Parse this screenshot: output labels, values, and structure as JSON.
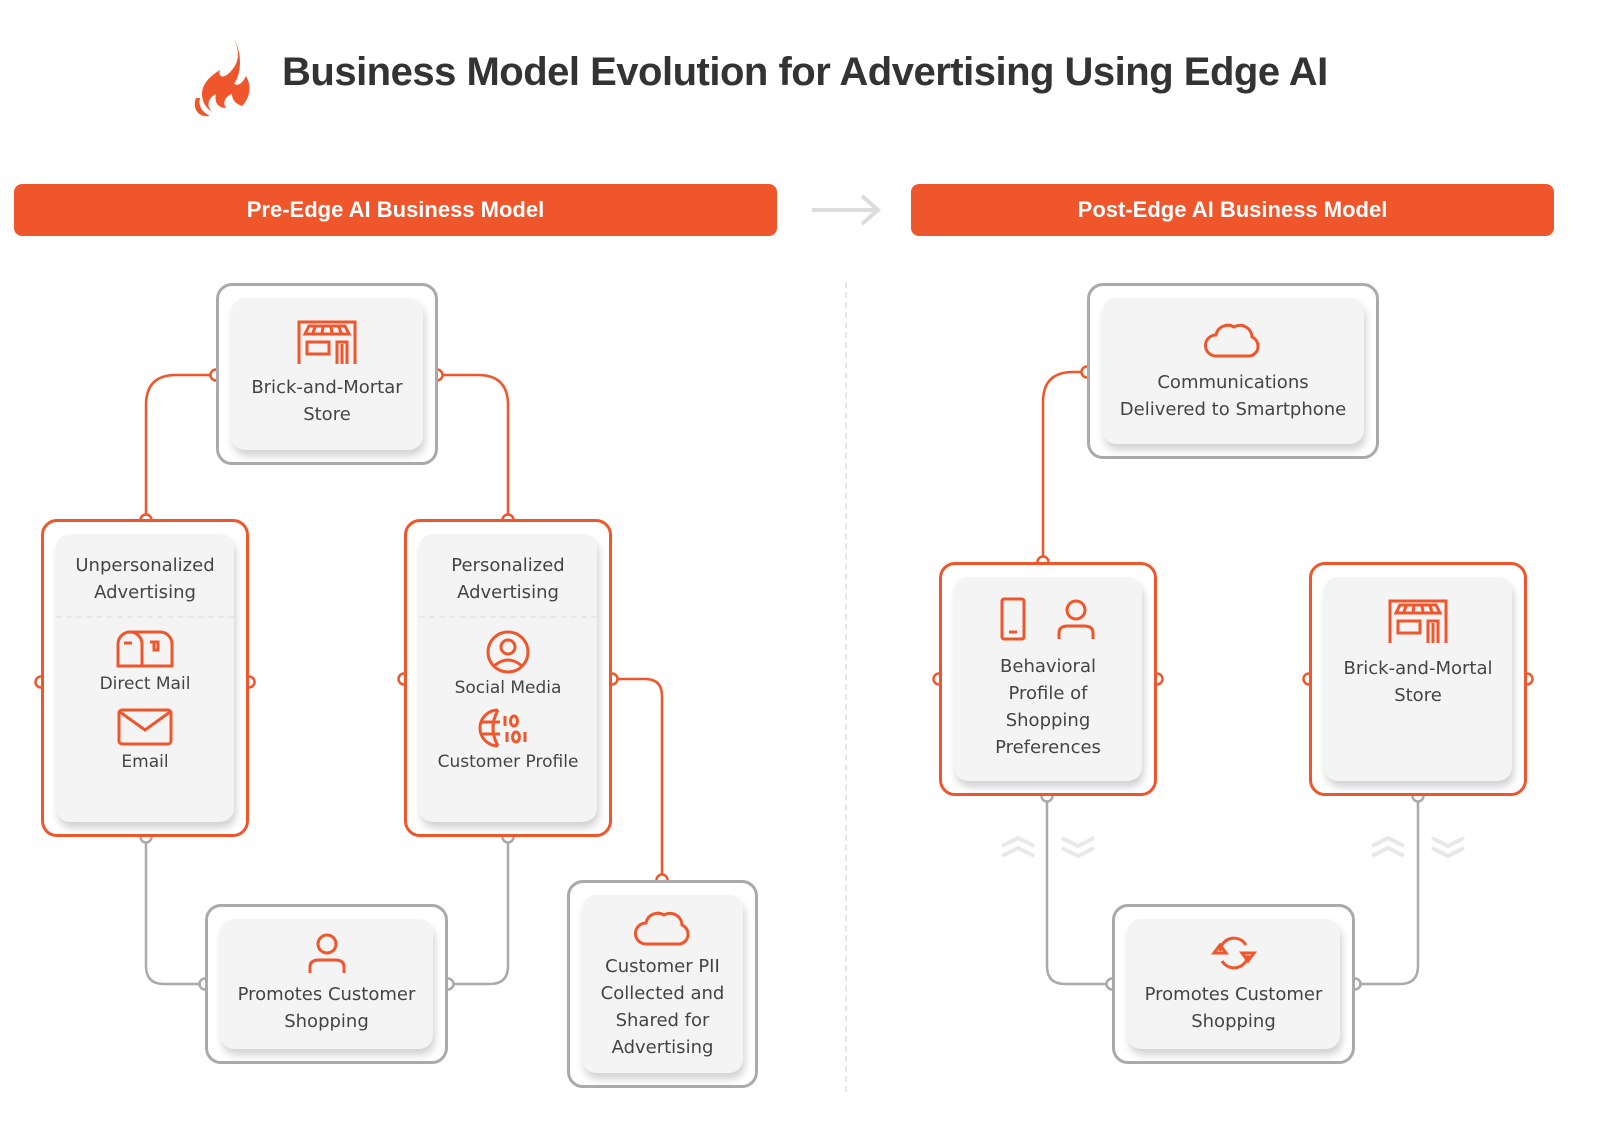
{
  "title": "Business Model Evolution for Advertising Using Edge AI",
  "colors": {
    "accent": "#f0562b",
    "frame_gray": "#aaaaaa",
    "card_bg": "#f4f4f4",
    "text": "#444444"
  },
  "pre": {
    "banner": "Pre-Edge AI Business Model",
    "store": {
      "icon": "storefront-icon",
      "label": "Brick-and-Mortar Store"
    },
    "unpersonalized": {
      "title": "Unpersonalized Advertising",
      "items": [
        {
          "icon": "mailbox-icon",
          "label": "Direct Mail"
        },
        {
          "icon": "envelope-icon",
          "label": "Email"
        }
      ]
    },
    "personalized": {
      "title": "Personalized Advertising",
      "items": [
        {
          "icon": "user-circle-icon",
          "label": "Social Media"
        },
        {
          "icon": "globe-binary-icon",
          "label": "Customer Profile"
        }
      ]
    },
    "promotes": {
      "icon": "person-icon",
      "label": "Promotes Customer Shopping"
    },
    "pii": {
      "icon": "cloud-icon",
      "label": "Customer PII Collected and Shared for Advertising"
    }
  },
  "post": {
    "banner": "Post-Edge AI Business Model",
    "communications": {
      "icon": "cloud-icon",
      "label": "Communications Delivered to Smartphone"
    },
    "behavioral": {
      "icons": [
        "smartphone-icon",
        "person-icon"
      ],
      "label": "Behavioral Profile of Shopping Preferences"
    },
    "store": {
      "icon": "storefront-icon",
      "label": "Brick-and-Mortal Store"
    },
    "promotes": {
      "icon": "refresh-cycle-icon",
      "label": "Promotes Customer Shopping"
    }
  }
}
